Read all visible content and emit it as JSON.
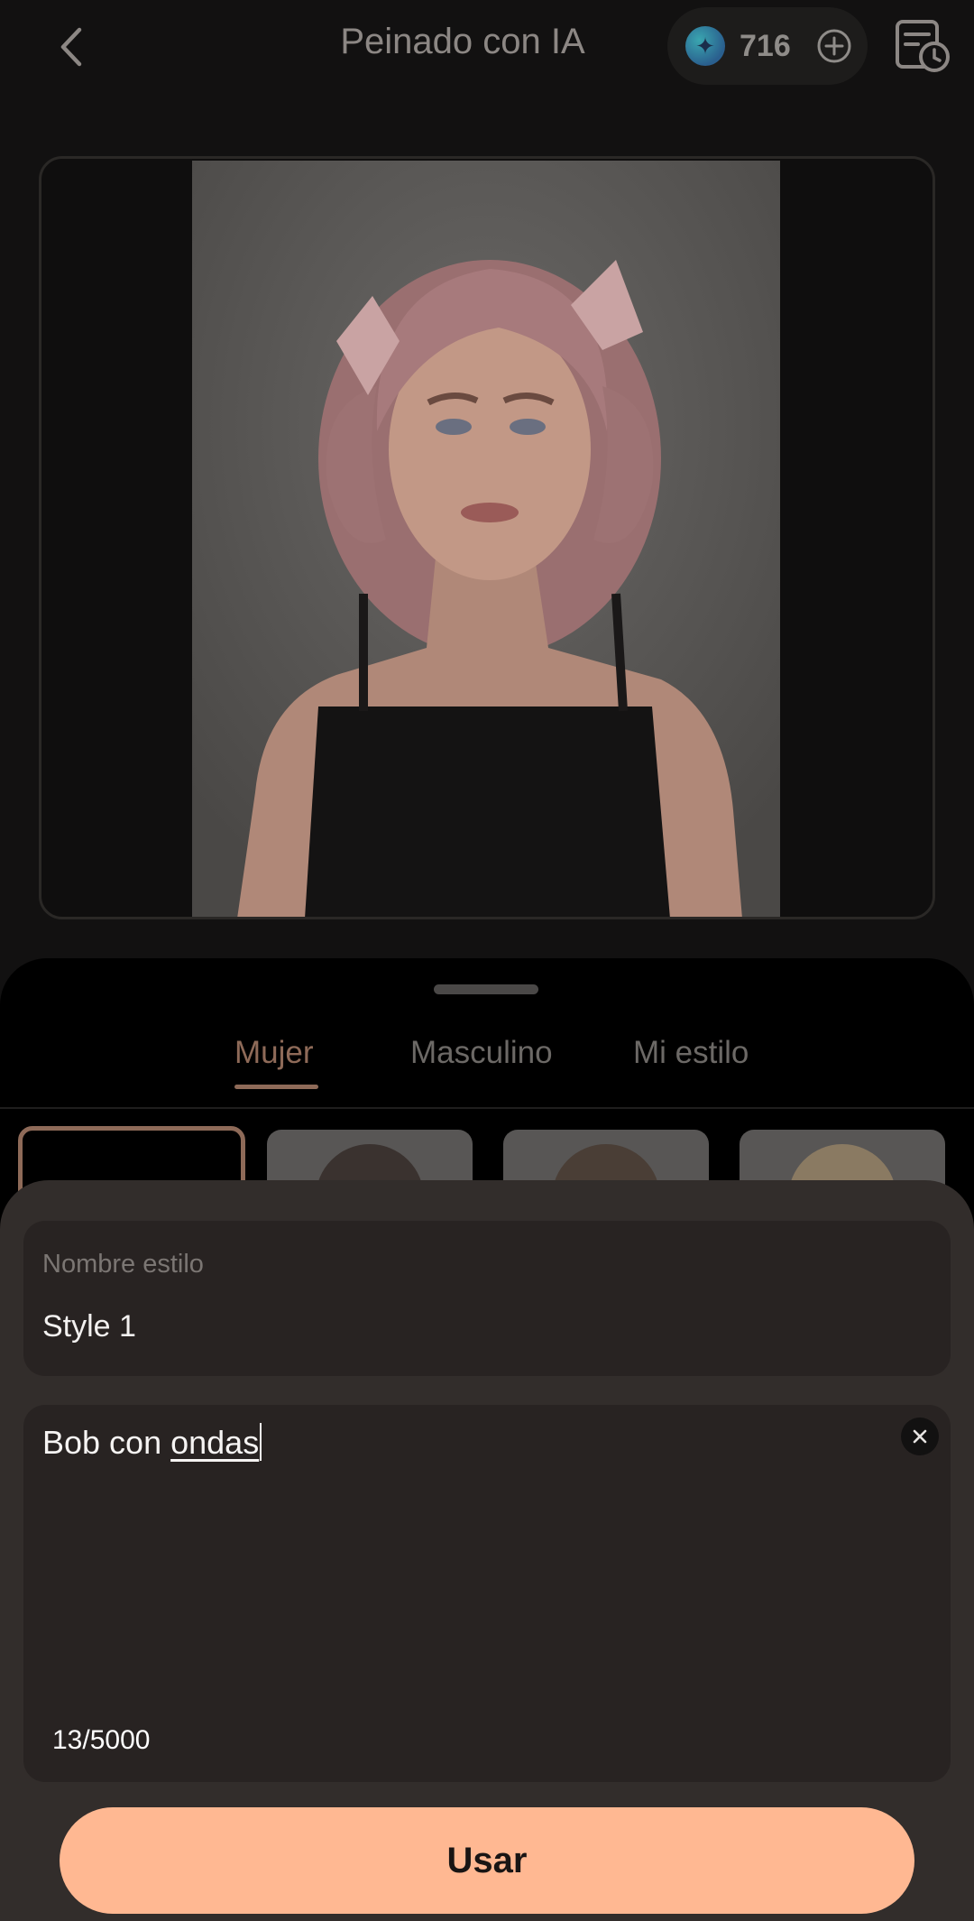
{
  "header": {
    "title": "Peinado con IA",
    "credits": "716",
    "back_icon": "chevron-left-icon",
    "credit_icon": "gem-icon",
    "add_credits_icon": "plus-circle-icon",
    "history_icon": "history-list-icon"
  },
  "preview": {
    "photo_description_icon": "portrait-image"
  },
  "tabs": [
    {
      "label": "Mujer",
      "active": true
    },
    {
      "label": "Masculino",
      "active": false
    },
    {
      "label": "Mi estilo",
      "active": false
    }
  ],
  "sheet": {
    "name_label": "Nombre estilo",
    "name_value": "Style 1",
    "prompt_plain": "Bob con ",
    "prompt_underlined": "ondas",
    "counter": "13/5000",
    "clear_icon": "close-icon",
    "use_button": "Usar"
  },
  "colors": {
    "accent": "#8e6a58",
    "button": "#ffb892",
    "sheet_bg": "#322d2b",
    "card_bg": "#282322"
  }
}
